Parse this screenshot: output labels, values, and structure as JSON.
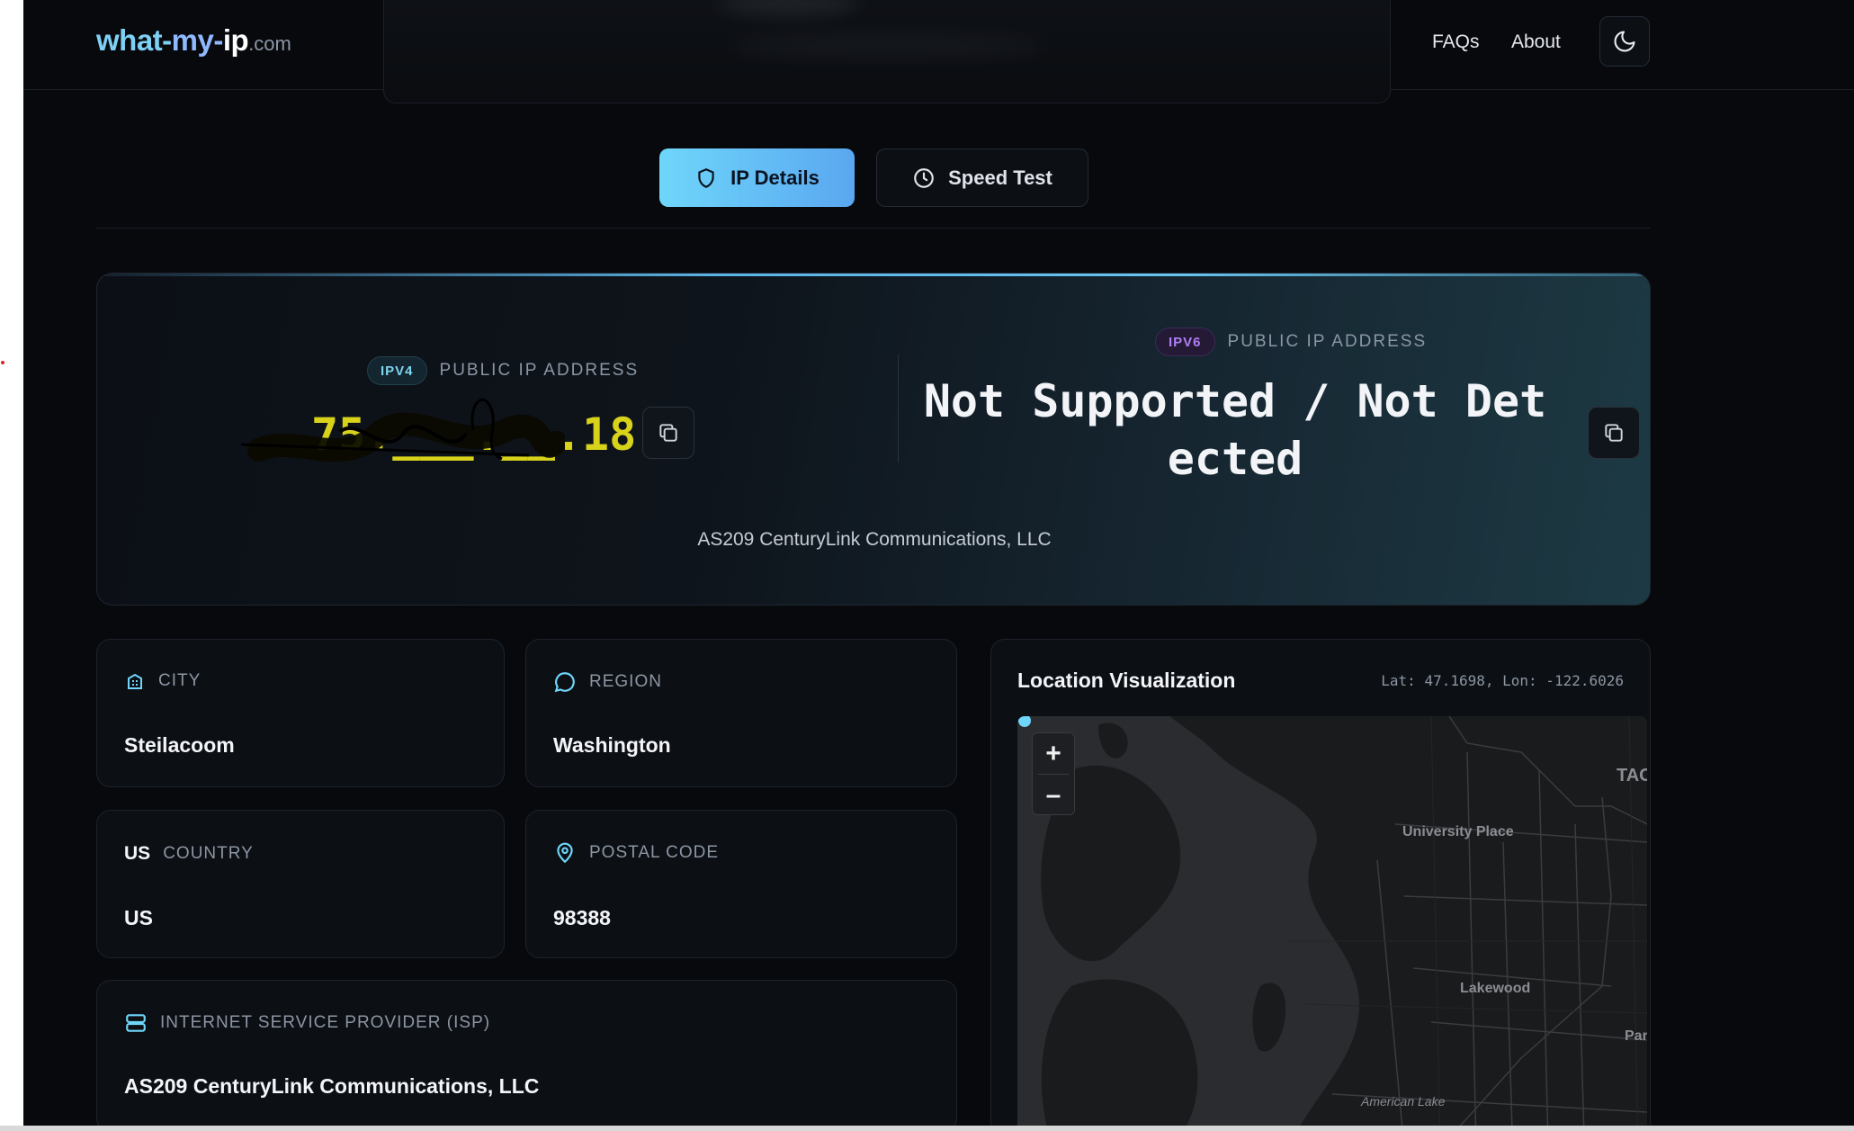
{
  "header": {
    "logo": {
      "part1": "what-",
      "part2": "my-",
      "part3": "ip",
      "tld": ".com"
    },
    "nav": [
      {
        "label": "FAQs"
      },
      {
        "label": "About"
      }
    ],
    "theme_toggle_icon": "moon-icon"
  },
  "tabs": [
    {
      "label": "IP Details",
      "icon": "shield-icon",
      "active": true
    },
    {
      "label": "Speed Test",
      "icon": "clock-icon",
      "active": false
    }
  ],
  "hero": {
    "ipv4": {
      "badge": "IPV4",
      "label": "PUBLIC IP ADDRESS",
      "value": "75.___.__.18"
    },
    "ipv6": {
      "badge": "IPV6",
      "label": "PUBLIC IP ADDRESS",
      "value": "Not Supported / Not Detected"
    },
    "isp": "AS209 CenturyLink Communications, LLC"
  },
  "cards": {
    "city": {
      "label": "CITY",
      "value": "Steilacoom",
      "icon": "building-icon"
    },
    "region": {
      "label": "REGION",
      "value": "Washington",
      "icon": "chat-bubble-icon"
    },
    "country": {
      "label": "COUNTRY",
      "value": "US",
      "code": "US"
    },
    "postal": {
      "label": "POSTAL CODE",
      "value": "98388",
      "icon": "map-pin-icon"
    },
    "isp": {
      "label": "INTERNET SERVICE PROVIDER (ISP)",
      "value": "AS209 CenturyLink Communications, LLC",
      "icon": "server-icon"
    }
  },
  "map": {
    "title": "Location Visualization",
    "coords": "Lat: 47.1698, Lon: -122.6026",
    "zoom_in": "+",
    "zoom_out": "–",
    "labels": [
      {
        "text": "TAC"
      },
      {
        "text": "University Place"
      },
      {
        "text": "Lakewood"
      },
      {
        "text": "Par"
      },
      {
        "text": "American Lake"
      }
    ]
  },
  "colors": {
    "background": "#07090d",
    "accent_cyan": "#6fd6fa",
    "accent_blue": "#5aa7f0",
    "ipv4_text": "#d8d21a",
    "ipv6_badge": "#b07ef5"
  }
}
